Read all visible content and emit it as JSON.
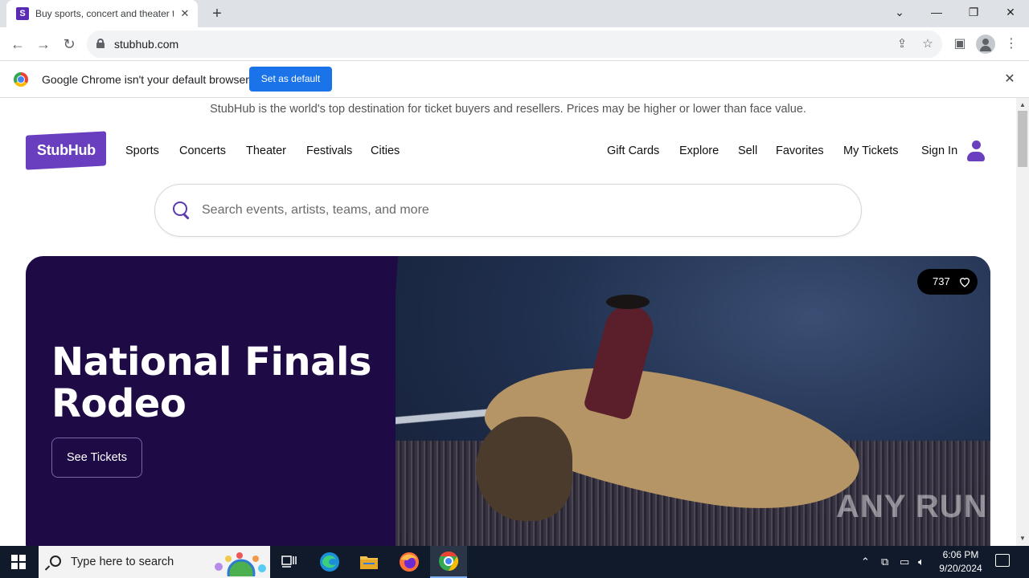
{
  "browser": {
    "tab_title": "Buy sports, concert and theater tickets",
    "tab_favicon_letter": "S",
    "url": "stubhub.com"
  },
  "infobar": {
    "message": "Google Chrome isn't your default browser",
    "button_label": "Set as default"
  },
  "page": {
    "disclaimer": "StubHub is the world's top destination for ticket buyers and resellers. Prices may be higher or lower than face value.",
    "logo_text": "StubHub",
    "nav_left": [
      "Sports",
      "Concerts",
      "Theater",
      "Festivals",
      "Cities"
    ],
    "nav_right": [
      "Gift Cards",
      "Explore",
      "Sell",
      "Favorites",
      "My Tickets",
      "Sign In"
    ],
    "search_placeholder": "Search events, artists, teams, and more",
    "hero": {
      "title": "National Finals Rodeo",
      "button_label": "See Tickets",
      "favorites_count": "737",
      "watermark": "ANY RUN"
    },
    "accent_color": "#6a3fbf",
    "hero_bg_color": "#1e0a45"
  },
  "taskbar": {
    "search_placeholder": "Type here to search",
    "time": "6:06 PM",
    "date": "9/20/2024"
  }
}
